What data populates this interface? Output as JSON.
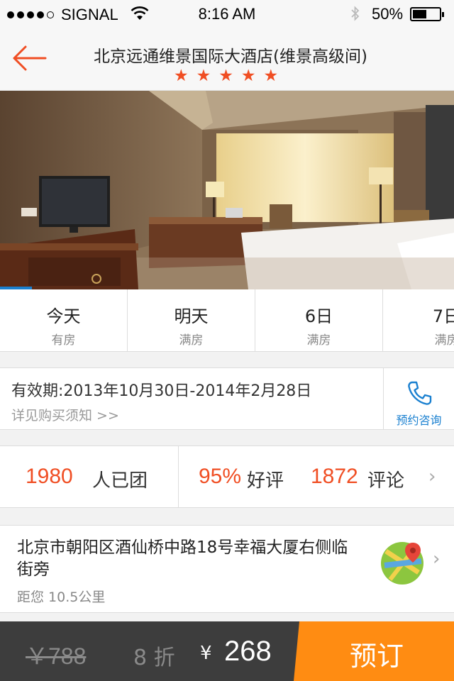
{
  "status_bar": {
    "carrier": "SIGNAL",
    "time": "8:16 AM",
    "battery": "50%",
    "battery_level": 0.5
  },
  "header": {
    "title": "北京远通维景国际大酒店(维景高级间)",
    "stars": "★★★★★",
    "rating": 5
  },
  "hero": {
    "slide_progress": 0.07
  },
  "dates": [
    {
      "day": "今天",
      "status": "有房"
    },
    {
      "day": "明天",
      "status": "满房"
    },
    {
      "day": "6日",
      "status": "满房"
    },
    {
      "day": "7日",
      "status": "满房"
    }
  ],
  "validity": {
    "period": "有效期:2013年10月30日-2014年2月28日",
    "notice": "详见购买须知 >>",
    "consult_label": "预约咨询"
  },
  "stats": {
    "group_count": "1980",
    "group_label": "人已团",
    "positive_rate": "95%",
    "positive_label": "好评",
    "review_count": "1872",
    "review_label": "评论"
  },
  "address": {
    "text": "北京市朝阳区酒仙桥中路18号幸福大厦右侧临街旁",
    "distance": "距您 10.5公里"
  },
  "purchase": {
    "original_price": "￥788",
    "discount": "8 折",
    "currency": "¥",
    "price": "268",
    "book_label": "预订"
  },
  "colors": {
    "accent": "#f04e23",
    "link": "#1a80d0",
    "book": "#ff8c12",
    "bar": "#3d3d3d"
  }
}
